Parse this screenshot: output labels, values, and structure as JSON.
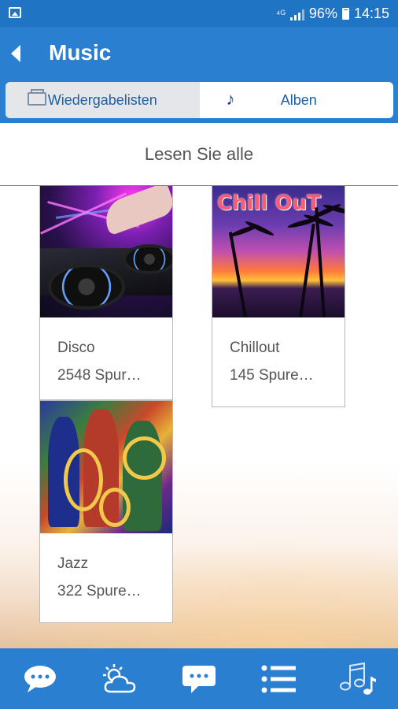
{
  "status_bar": {
    "battery": "96%",
    "time": "14:15"
  },
  "app_bar": {
    "title": "Music"
  },
  "tabs": [
    {
      "label": "Wiedergabelisten",
      "active": true,
      "icon": "playlist-icon"
    },
    {
      "label": "Alben",
      "active": false,
      "icon": "music-note-icon"
    }
  ],
  "read_all": {
    "label": "Lesen Sie alle"
  },
  "playlists": [
    {
      "name": "Disco",
      "count": "2548 Spur…",
      "art": "disco-dj-decks"
    },
    {
      "name": "Chillout",
      "count": "145 Spure…",
      "art": "chill-out-palm-sunset",
      "art_text": "Chill OuT"
    },
    {
      "name": "Jazz",
      "count": "322 Spure…",
      "art": "jazz-saxophone-painting"
    }
  ],
  "bottom_nav": [
    {
      "name": "chat-icon"
    },
    {
      "name": "weather-icon"
    },
    {
      "name": "message-icon"
    },
    {
      "name": "list-icon"
    },
    {
      "name": "music-icon"
    }
  ],
  "colors": {
    "primary": "#2a7fd0",
    "status_bar": "#1f74c4",
    "tab_text": "#1c5fa8"
  }
}
